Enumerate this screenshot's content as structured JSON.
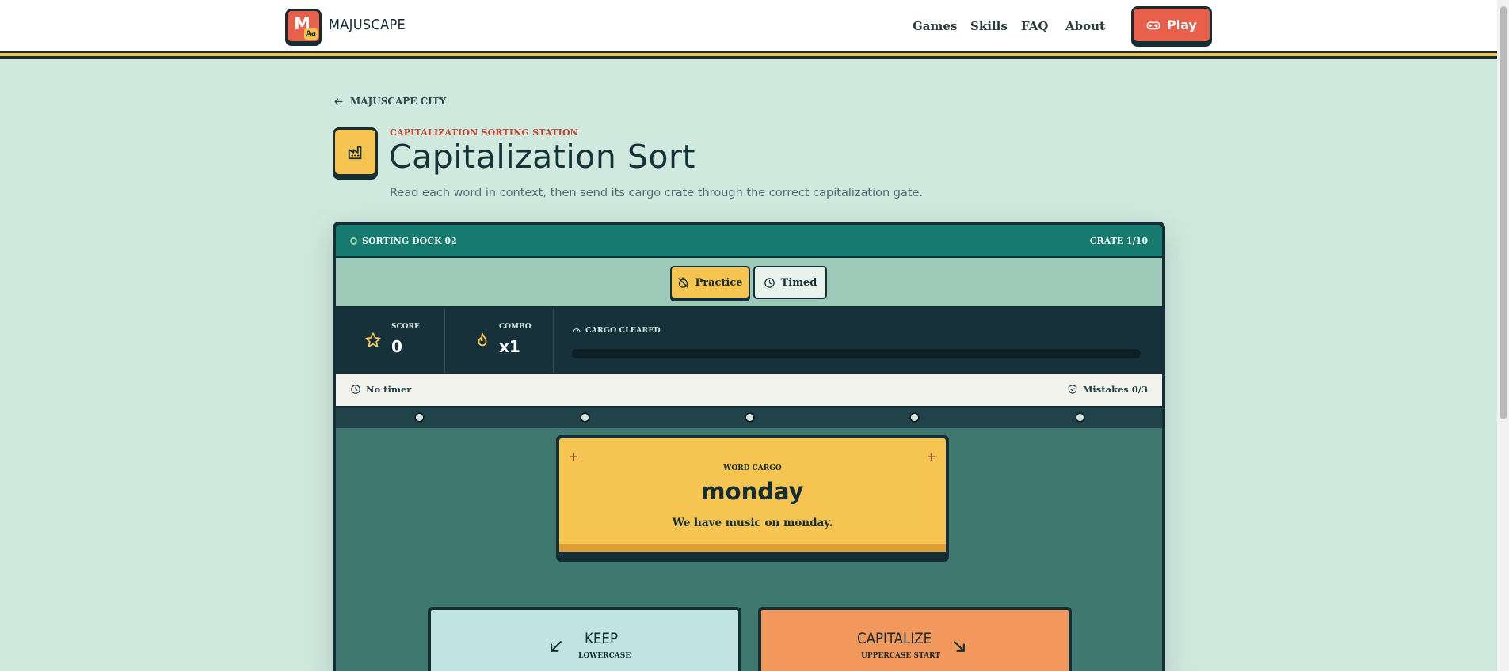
{
  "header": {
    "logo_letter": "M",
    "logo_badge": "Aa",
    "brand": "MAJUSCAPE",
    "nav": [
      "Games",
      "Skills",
      "FAQ",
      "About"
    ],
    "play_label": "Play"
  },
  "breadcrumb": {
    "label": "MAJUSCAPE CITY"
  },
  "page": {
    "eyebrow": "CAPITALIZATION SORTING STATION",
    "title": "Capitalization Sort",
    "subtitle": "Read each word in context, then send its cargo crate through the correct capitalization gate."
  },
  "game": {
    "dock_label": "SORTING DOCK 02",
    "crate_count": "CRATE 1/10",
    "modes": {
      "practice": "Practice",
      "timed": "Timed",
      "active": "Practice"
    },
    "stats": {
      "score_label": "SCORE",
      "score": "0",
      "combo_label": "COMBO",
      "combo": "x1",
      "cargo_label": "CARGO CLEARED",
      "cargo_progress": 0
    },
    "timer": "No timer",
    "mistakes": "Mistakes 0/3",
    "crate": {
      "label": "WORD CARGO",
      "word": "monday",
      "sentence": "We have music on monday."
    },
    "gates": {
      "keep_title": "KEEP",
      "keep_sub": "LOWERCASE",
      "cap_title": "CAPITALIZE",
      "cap_sub": "UPPERCASE START"
    }
  },
  "colors": {
    "accent_red": "#e8604c",
    "accent_yellow": "#f5c451",
    "teal": "#177a70",
    "dark": "#142e34",
    "background": "#d0e9df"
  }
}
